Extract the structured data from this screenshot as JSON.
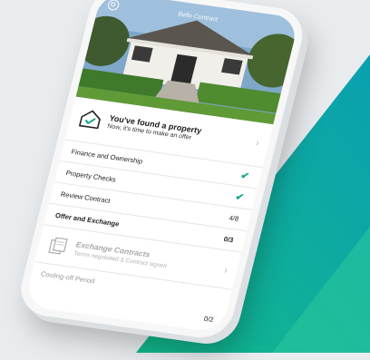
{
  "hero": {
    "title": "Bello Contract"
  },
  "found": {
    "title": "You've found a property",
    "subtitle": "Now, it's time to make an offer"
  },
  "steps": [
    {
      "label": "Finance and Ownership",
      "status": "check"
    },
    {
      "label": "Property Checks",
      "status": "check"
    },
    {
      "label": "Review Contract",
      "count": "4/8"
    },
    {
      "label": "Offer and Exchange",
      "count": "0/3"
    }
  ],
  "exchange": {
    "title": "Exchange Contracts",
    "subtitle": "Terms negotiated & Contract signed"
  },
  "cooling": {
    "label": "Cooling-off Period",
    "count": "0/2"
  },
  "colors": {
    "accent": "#17a58d",
    "background_green": "#0fb39a"
  }
}
